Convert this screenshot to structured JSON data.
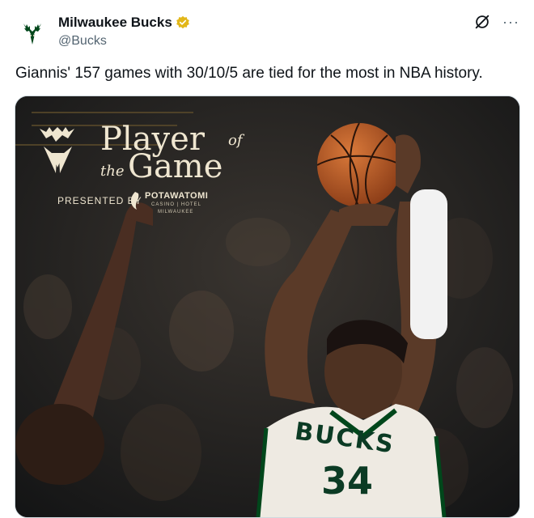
{
  "account": {
    "display_name": "Milwaukee Bucks",
    "handle": "@Bucks",
    "avatar_icon": "bucks-deer-logo-icon",
    "verified_icon": "gold-verified-badge-icon",
    "verified_color": "#e2b719"
  },
  "header_actions": {
    "grok_icon": "grok-icon",
    "more_label": "···"
  },
  "tweet": {
    "text": "Giannis' 157 games with 30/10/5 are tied for the most in NBA history."
  },
  "media": {
    "graphic": {
      "title_line1": "Player",
      "title_of": "of",
      "title_the": "the",
      "title_line2": "Game",
      "presented_by": "PRESENTED BY",
      "sponsor_name": "POTAWATOMI",
      "sponsor_sub": "CASINO | HOTEL",
      "sponsor_city": "MILWAUKEE",
      "jersey_text": "BUCKS",
      "jersey_number": "34"
    },
    "colors": {
      "cream": "#efe6d0",
      "bucks_green": "#00471b",
      "ball_orange": "#c8672f"
    }
  }
}
